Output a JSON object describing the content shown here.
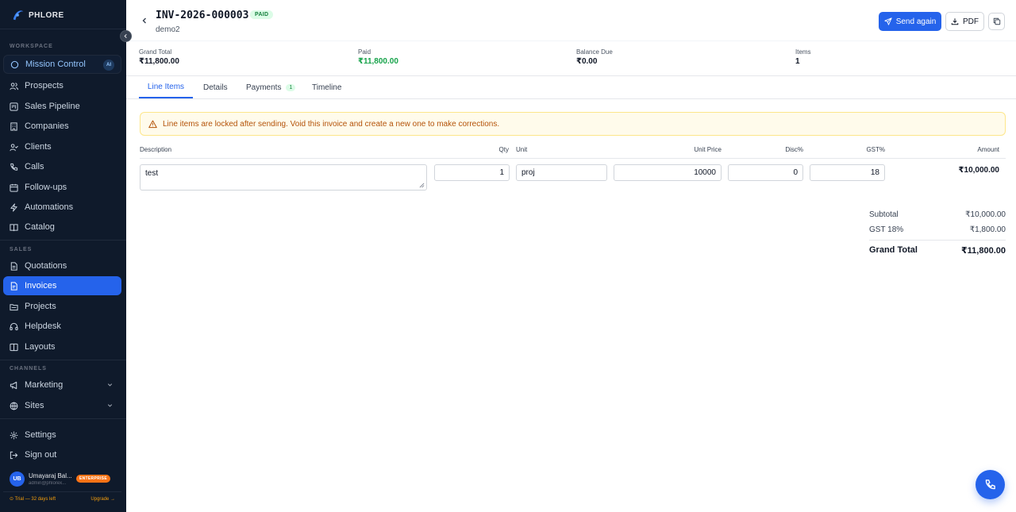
{
  "brand": {
    "name": "PHLORE"
  },
  "sidebar": {
    "sections": {
      "workspace": "WORKSPACE",
      "sales": "SALES",
      "channels": "CHANNELS"
    },
    "mission": {
      "label": "Mission Control",
      "badge": "AI"
    },
    "items": [
      {
        "label": "Prospects"
      },
      {
        "label": "Sales Pipeline"
      },
      {
        "label": "Companies"
      },
      {
        "label": "Clients"
      },
      {
        "label": "Calls"
      },
      {
        "label": "Follow-ups"
      },
      {
        "label": "Automations"
      },
      {
        "label": "Catalog"
      },
      {
        "label": "Quotations"
      },
      {
        "label": "Invoices"
      },
      {
        "label": "Projects"
      },
      {
        "label": "Helpdesk"
      },
      {
        "label": "Layouts"
      },
      {
        "label": "Marketing"
      },
      {
        "label": "Sites"
      },
      {
        "label": "Settings"
      },
      {
        "label": "Sign out"
      }
    ],
    "user": {
      "initials": "UB",
      "name": "Umayaraj Bal...",
      "email": "admin@phlorex...",
      "plan": "ENTERPRISE"
    },
    "trial": {
      "text": "⊙ Trial — 32 days left",
      "upgrade": "Upgrade →"
    }
  },
  "invoice": {
    "number": "INV-2026-000003",
    "status": "PAID",
    "client": "demo2",
    "actions": {
      "send": "Send again",
      "pdf": "PDF"
    }
  },
  "stats": [
    {
      "label": "Grand Total",
      "value": "₹11,800.00"
    },
    {
      "label": "Paid",
      "value": "₹11,800.00"
    },
    {
      "label": "Balance Due",
      "value": "₹0.00"
    },
    {
      "label": "Items",
      "value": "1"
    }
  ],
  "tabs": [
    {
      "label": "Line Items"
    },
    {
      "label": "Details"
    },
    {
      "label": "Payments",
      "count": "1"
    },
    {
      "label": "Timeline"
    }
  ],
  "alert": "Line items are locked after sending. Void this invoice and create a new one to make corrections.",
  "table": {
    "headers": {
      "description": "Description",
      "qty": "Qty",
      "unit": "Unit",
      "unit_price": "Unit Price",
      "disc": "Disc%",
      "gst": "GST%",
      "amount": "Amount"
    },
    "rows": [
      {
        "description": "test",
        "qty": "1",
        "unit": "proj",
        "unit_price": "10000",
        "disc": "0",
        "gst": "18",
        "amount": "₹10,000.00"
      }
    ]
  },
  "totals": {
    "subtotal_label": "Subtotal",
    "subtotal": "₹10,000.00",
    "gst_label": "GST 18%",
    "gst": "₹1,800.00",
    "grand_label": "Grand Total",
    "grand": "₹11,800.00"
  },
  "colors": {
    "accent": "#2563eb",
    "sidebar_bg": "#0f1a2b",
    "paid": "#16a34a",
    "warning": "#b45309"
  }
}
